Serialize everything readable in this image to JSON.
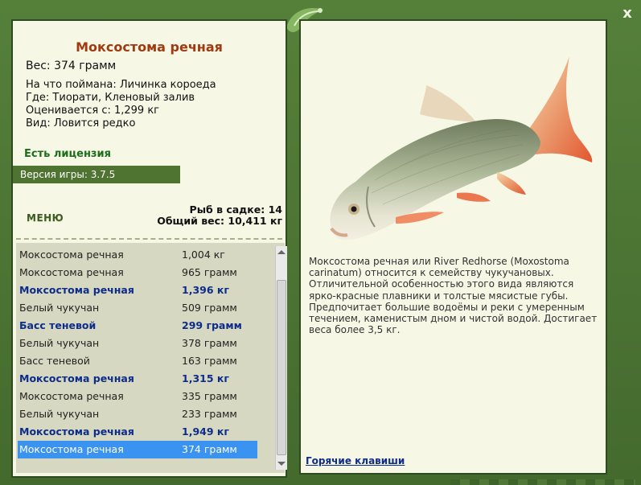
{
  "window": {
    "close_label": "x"
  },
  "fish": {
    "title": "Моксостома речная",
    "weight": "Вес: 374 грамм",
    "caught_on": "На что поймана: Личинка короеда",
    "where": "Где: Тиорати, Кленовый залив",
    "valued_from": "Оценивается с: 1,299 кг",
    "kind": "Вид: Ловится редко"
  },
  "license_label": "Есть лицензия",
  "version_label": "Версия игры: 3.7.5",
  "menu_label": "МЕНЮ",
  "stats": {
    "fish_in_net": "Рыб в садке: 14",
    "total_weight": "Общий вес: 10,411 кг"
  },
  "catch_list": [
    {
      "name": "Моксостома речная",
      "weight": "1,004 кг",
      "bold": false,
      "selected": false
    },
    {
      "name": "Моксостома речная",
      "weight": "965 грамм",
      "bold": false,
      "selected": false
    },
    {
      "name": "Моксостома речная",
      "weight": "1,396 кг",
      "bold": true,
      "selected": false
    },
    {
      "name": "Белый чукучан",
      "weight": "509 грамм",
      "bold": false,
      "selected": false
    },
    {
      "name": "Басс теневой",
      "weight": "299 грамм",
      "bold": true,
      "selected": false
    },
    {
      "name": "Белый чукучан",
      "weight": "378 грамм",
      "bold": false,
      "selected": false
    },
    {
      "name": "Басс теневой",
      "weight": "163 грамм",
      "bold": false,
      "selected": false
    },
    {
      "name": "Моксостома речная",
      "weight": "1,315 кг",
      "bold": true,
      "selected": false
    },
    {
      "name": "Моксостома речная",
      "weight": "335 грамм",
      "bold": false,
      "selected": false
    },
    {
      "name": "Белый чукучан",
      "weight": "233 грамм",
      "bold": false,
      "selected": false
    },
    {
      "name": "Моксостома речная",
      "weight": "1,949 кг",
      "bold": true,
      "selected": false
    },
    {
      "name": "Моксостома речная",
      "weight": "374 грамм",
      "bold": false,
      "selected": true
    }
  ],
  "description": "Моксостома речная или River Redhorse (Moxostoma carinatum) относится к семейству чукучановых. Отличительной особенностью этого вида являются ярко-красные плавники и толстые мясистые губы. Предпочитает большие водоёмы и реки с умеренным течением, каменистым дном и чистой водой. Достигает веса более 3,5 кг.",
  "hotkeys_label": "Горячие клавиши",
  "icons": {
    "close": "close-icon",
    "logo": "leaf-lizard-icon"
  },
  "colors": {
    "frame": "#4d7335",
    "panel": "#f7f7e6",
    "title": "#a13a10",
    "selected": "#3a93f1"
  }
}
